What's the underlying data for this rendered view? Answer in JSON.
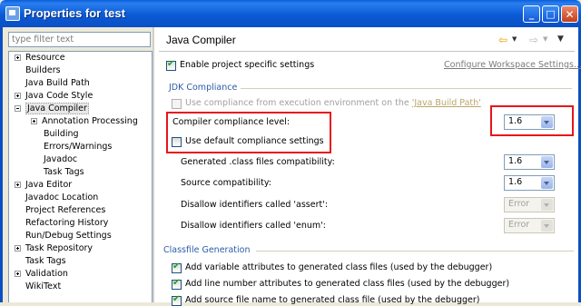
{
  "window": {
    "title": "Properties for test",
    "buttons": {
      "minimize": "_",
      "maximize": "□",
      "close": "✕"
    }
  },
  "filter": {
    "placeholder": "type filter text"
  },
  "tree": [
    {
      "label": "Resource",
      "expander": "plus"
    },
    {
      "label": "Builders",
      "expander": "none"
    },
    {
      "label": "Java Build Path",
      "expander": "none"
    },
    {
      "label": "Java Code Style",
      "expander": "plus"
    },
    {
      "label": "Java Compiler",
      "expander": "minus",
      "selected": true
    },
    {
      "label": "Annotation Processing",
      "expander": "plus"
    },
    {
      "label": "Building",
      "expander": "none"
    },
    {
      "label": "Errors/Warnings",
      "expander": "none"
    },
    {
      "label": "Javadoc",
      "expander": "none"
    },
    {
      "label": "Task Tags",
      "expander": "none"
    },
    {
      "label": "Java Editor",
      "expander": "plus"
    },
    {
      "label": "Javadoc Location",
      "expander": "none"
    },
    {
      "label": "Project References",
      "expander": "none"
    },
    {
      "label": "Refactoring History",
      "expander": "none"
    },
    {
      "label": "Run/Debug Settings",
      "expander": "none"
    },
    {
      "label": "Task Repository",
      "expander": "plus"
    },
    {
      "label": "Task Tags",
      "expander": "none"
    },
    {
      "label": "Validation",
      "expander": "plus"
    },
    {
      "label": "WikiText",
      "expander": "none"
    }
  ],
  "page": {
    "title": "Java Compiler",
    "icons": {
      "back": "back-arrow-icon",
      "forward": "forward-arrow-icon",
      "menu": "view-menu-icon"
    },
    "enable_project_specific": {
      "label": "Enable project specific settings",
      "checked": true
    },
    "configure_link": "Configure Workspace Settings...",
    "jdk_group": {
      "label": "JDK Compliance",
      "use_env": {
        "label_prefix": "Use compliance from execution environment on the ",
        "label_link": "'Java Build Path'",
        "checked": false,
        "enabled": false
      },
      "compliance_level": {
        "label": "Compiler compliance level:",
        "value": "1.6"
      },
      "use_default": {
        "label": "Use default compliance settings",
        "checked": false
      },
      "generated_class": {
        "label": "Generated .class files compatibility:",
        "value": "1.6"
      },
      "source_compat": {
        "label": "Source compatibility:",
        "value": "1.6"
      },
      "disallow_assert": {
        "label": "Disallow identifiers called 'assert':",
        "value": "Error",
        "enabled": false
      },
      "disallow_enum": {
        "label": "Disallow identifiers called 'enum':",
        "value": "Error",
        "enabled": false
      }
    },
    "classfile_group": {
      "label": "Classfile Generation",
      "items": [
        {
          "label": "Add variable attributes to generated class files (used by the debugger)",
          "checked": true
        },
        {
          "label": "Add line number attributes to generated class files (used by the debugger)",
          "checked": true
        },
        {
          "label": "Add source file name to generated class file (used by the debugger)",
          "checked": true
        }
      ]
    }
  },
  "highlight_color": "#e8151b"
}
